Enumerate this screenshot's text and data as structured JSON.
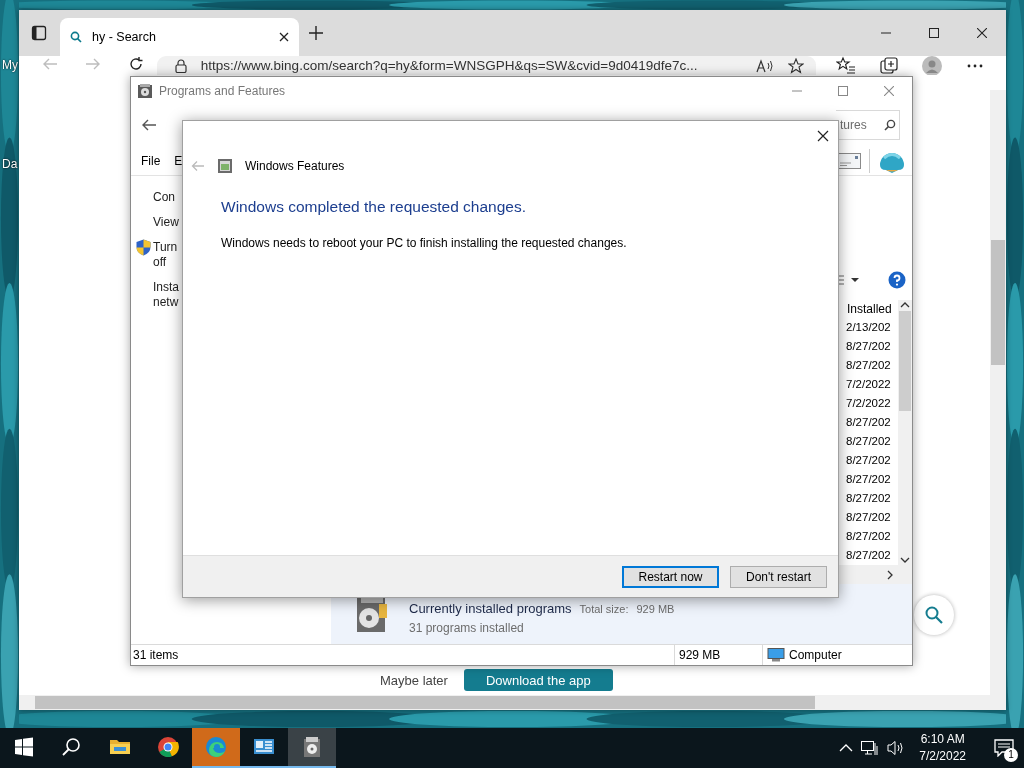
{
  "desktop": {
    "icon_labels": [
      "My",
      "Da"
    ]
  },
  "browser": {
    "tabs": [
      {
        "title": "hy - Search",
        "selected": true
      }
    ],
    "nav": {
      "back_disabled": true,
      "forward_disabled": true
    },
    "address": "https://www.bing.com/search?q=hy&form=WNSGPH&qs=SW&cvid=9d0419dfe7c...",
    "page": {
      "secondary_link": "Maybe later",
      "primary_button": "Download the app"
    }
  },
  "programs_window": {
    "title": "Programs and Features",
    "search": {
      "placeholder": "tures"
    },
    "menu": [
      "File",
      "E"
    ],
    "sidebar_links": [
      {
        "kind": "plain",
        "lines": [
          "Con"
        ]
      },
      {
        "kind": "plain",
        "lines": [
          "View"
        ]
      },
      {
        "kind": "shield",
        "lines": [
          "Turn",
          "off"
        ]
      },
      {
        "kind": "plain",
        "lines": [
          "Insta",
          "netw"
        ]
      }
    ],
    "column_header": "Installed",
    "dates": [
      "2/13/202",
      "8/27/202",
      "8/27/202",
      "7/2/2022",
      "7/2/2022",
      "8/27/202",
      "8/27/202",
      "8/27/202",
      "8/27/202",
      "8/27/202",
      "8/27/202",
      "8/27/202",
      "8/27/202"
    ],
    "details": {
      "title": "Currently installed programs",
      "size_label": "Total size:",
      "size": "929 MB",
      "count": "31 programs installed"
    },
    "status_bar": {
      "items": "31 items",
      "size": "929 MB",
      "location": "Computer"
    }
  },
  "dialog": {
    "title": "Windows Features",
    "heading": "Windows completed the requested changes.",
    "message": "Windows needs to reboot your PC to finish installing the requested changes.",
    "buttons": [
      {
        "label": "Restart now",
        "selected": true
      },
      {
        "label": "Don't restart",
        "selected": false
      }
    ]
  },
  "taskbar": {
    "apps": [
      {
        "kind": "explorer",
        "open": false,
        "selected": false,
        "attention": false
      },
      {
        "kind": "chrome",
        "open": false,
        "selected": false,
        "attention": false
      },
      {
        "kind": "edge",
        "open": true,
        "selected": false,
        "attention": true
      },
      {
        "kind": "panel",
        "open": true,
        "selected": false,
        "attention": false
      },
      {
        "kind": "programs",
        "open": true,
        "selected": true,
        "attention": false
      }
    ],
    "time": "6:10 AM",
    "date": "7/2/2022",
    "notification_count": "1"
  }
}
